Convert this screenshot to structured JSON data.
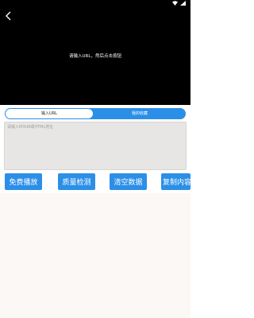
{
  "player": {
    "message": "请输入URL，然后点击按钮"
  },
  "tabs": [
    {
      "label": "输入URL",
      "active": true
    },
    {
      "label": "我的收藏",
      "active": false
    }
  ],
  "url_input": {
    "placeholder": "请输入M3U8或HTML地址",
    "value": ""
  },
  "buttons": {
    "free_play": "免费播放",
    "quality_check": "质量检测",
    "clear_data": "清空数据",
    "copy_content": "复制内容"
  },
  "icons": {
    "back": "back-arrow-icon",
    "wifi": "wifi-icon",
    "signal": "signal-icon"
  },
  "colors": {
    "accent": "#2b8fe8",
    "player_bg": "#000000",
    "input_bg": "#e8e6e4"
  }
}
